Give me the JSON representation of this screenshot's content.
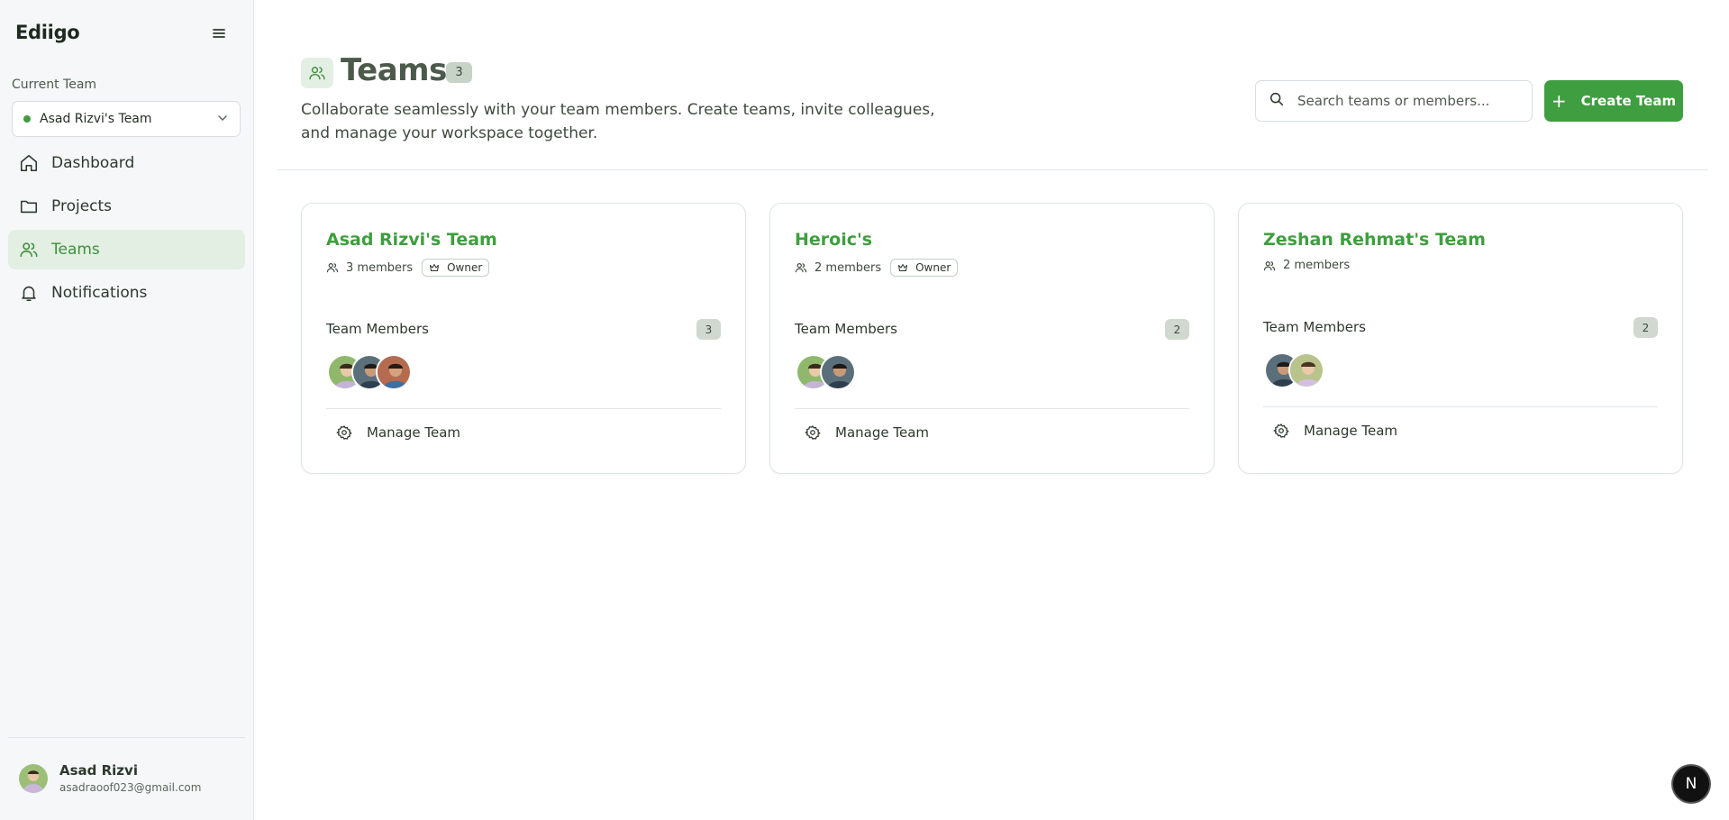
{
  "app": {
    "brand": "Ediigo"
  },
  "sidebar": {
    "current_team_label": "Current Team",
    "current_team": "Asad Rizvi's Team",
    "items": [
      {
        "label": "Dashboard",
        "icon": "home-icon",
        "active": false
      },
      {
        "label": "Projects",
        "icon": "folder-icon",
        "active": false
      },
      {
        "label": "Teams",
        "icon": "users-icon",
        "active": true
      },
      {
        "label": "Notifications",
        "icon": "bell-icon",
        "active": false
      }
    ],
    "user": {
      "name": "Asad Rizvi",
      "email": "asadraoof023@gmail.com"
    }
  },
  "header": {
    "title": "Teams",
    "count": "3",
    "description": "Collaborate seamlessly with your team members. Create teams, invite colleagues, and manage your workspace together.",
    "search_placeholder": "Search teams or members...",
    "create_label": "Create Team"
  },
  "teams": [
    {
      "name": "Asad Rizvi's Team",
      "members_text": "3 members",
      "owner": "Owner",
      "members_label": "Team Members",
      "member_count": "3",
      "manage_label": "Manage Team"
    },
    {
      "name": "Heroic's",
      "members_text": "2 members",
      "owner": "Owner",
      "members_label": "Team Members",
      "member_count": "2",
      "manage_label": "Manage Team"
    },
    {
      "name": "Zeshan Rehmat's Team",
      "members_text": "2 members",
      "members_label": "Team Members",
      "member_count": "2",
      "manage_label": "Manage Team"
    }
  ],
  "fab": {
    "label": "N"
  },
  "colors": {
    "accent": "#3f9e3f",
    "active_bg": "#e2efe2",
    "sidebar_bg": "#f5f7f9"
  }
}
